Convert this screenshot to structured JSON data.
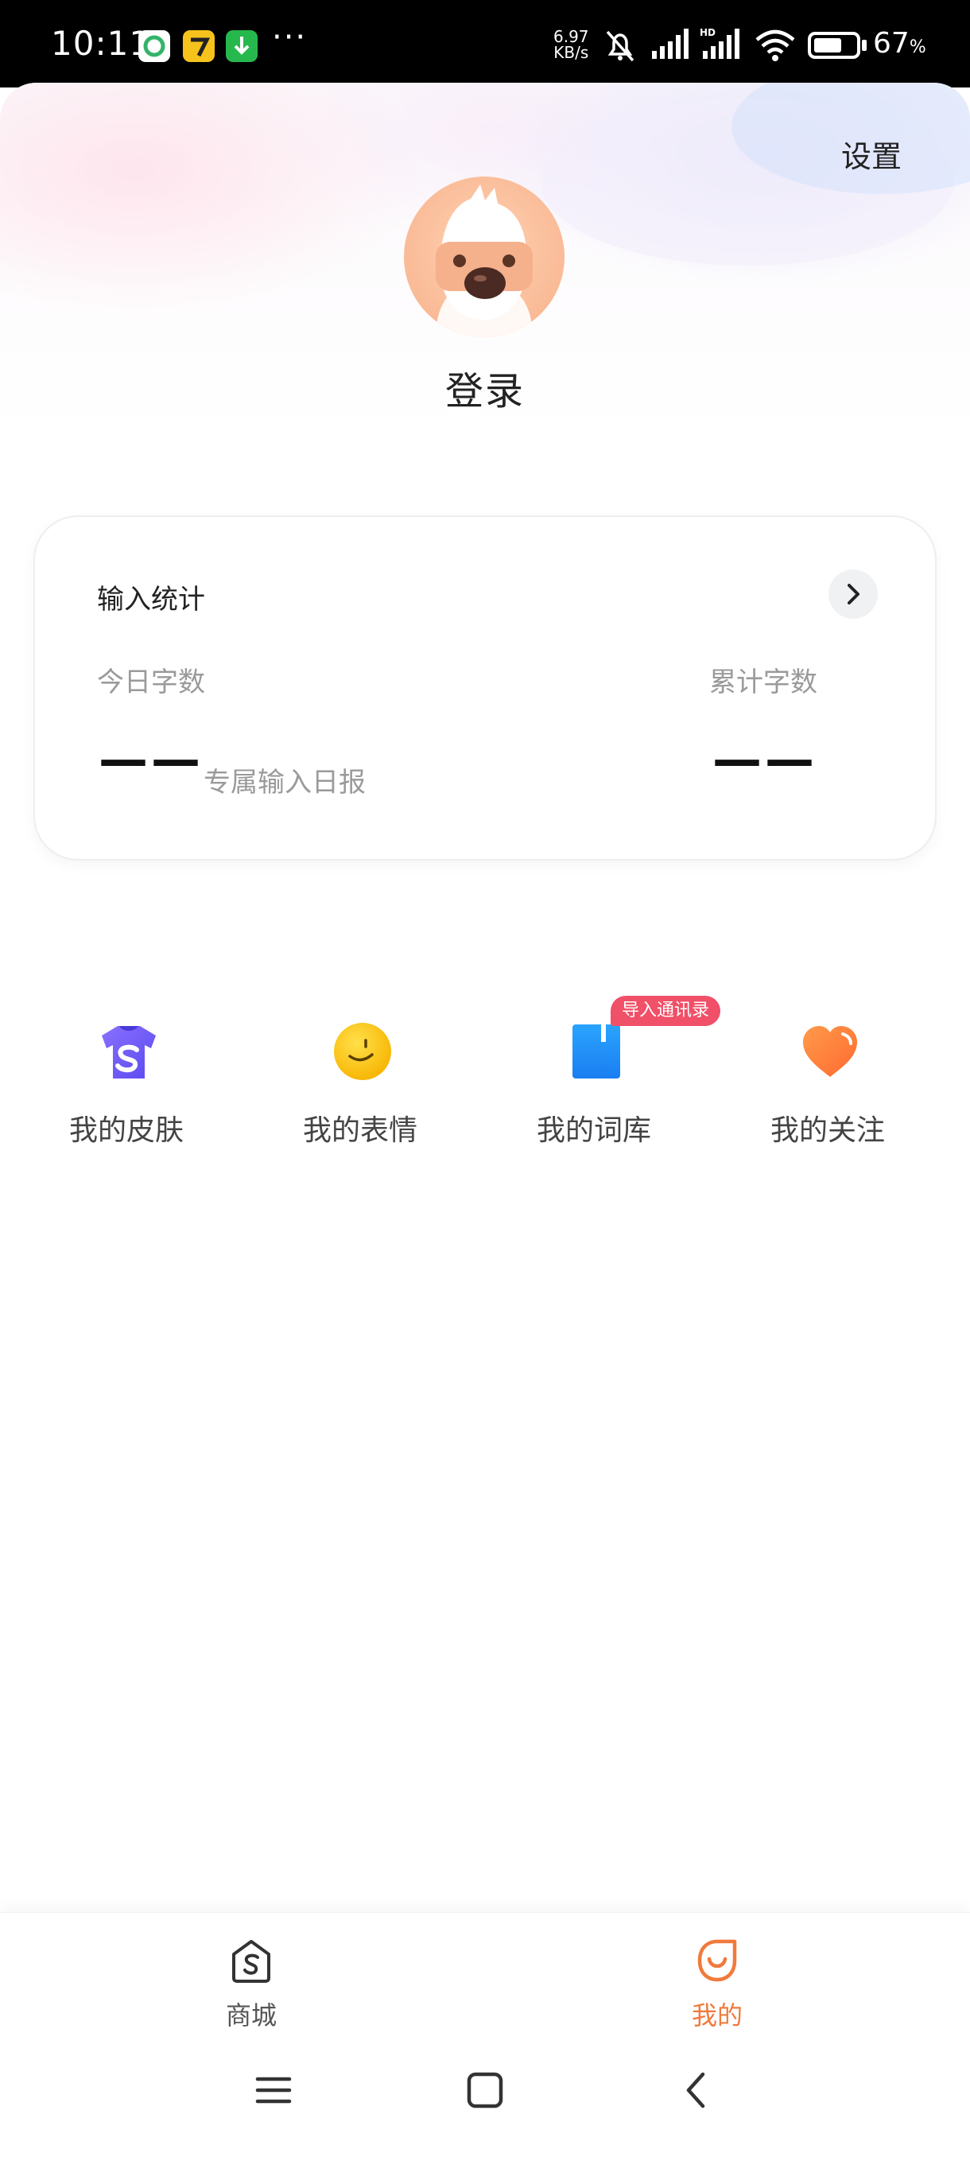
{
  "status_bar": {
    "time": "10:11",
    "net_speed_value": "6.97",
    "net_speed_unit": "KB/s",
    "network_type": "HD",
    "battery_percent": "67",
    "battery_unit": "%",
    "battery_level": 0.67,
    "overflow": "···"
  },
  "header": {
    "settings_label": "设置",
    "login_label": "登录"
  },
  "stats": {
    "title": "输入统计",
    "today_label": "今日字数",
    "today_value": "——",
    "report_label": "专属输入日报",
    "total_label": "累计字数",
    "total_value": "——"
  },
  "shortcuts": [
    {
      "label": "我的皮肤",
      "icon": "shirt-icon"
    },
    {
      "label": "我的表情",
      "icon": "smiley-icon"
    },
    {
      "label": "我的词库",
      "icon": "book-icon",
      "badge": "导入通讯录"
    },
    {
      "label": "我的关注",
      "icon": "heart-icon"
    }
  ],
  "tabs": [
    {
      "label": "商城",
      "icon": "store-icon",
      "active": false
    },
    {
      "label": "我的",
      "icon": "profile-icon",
      "active": true
    }
  ],
  "colors": {
    "accent": "#f07a3c",
    "badge": "#f05068",
    "inactive_tab": "#555555"
  }
}
